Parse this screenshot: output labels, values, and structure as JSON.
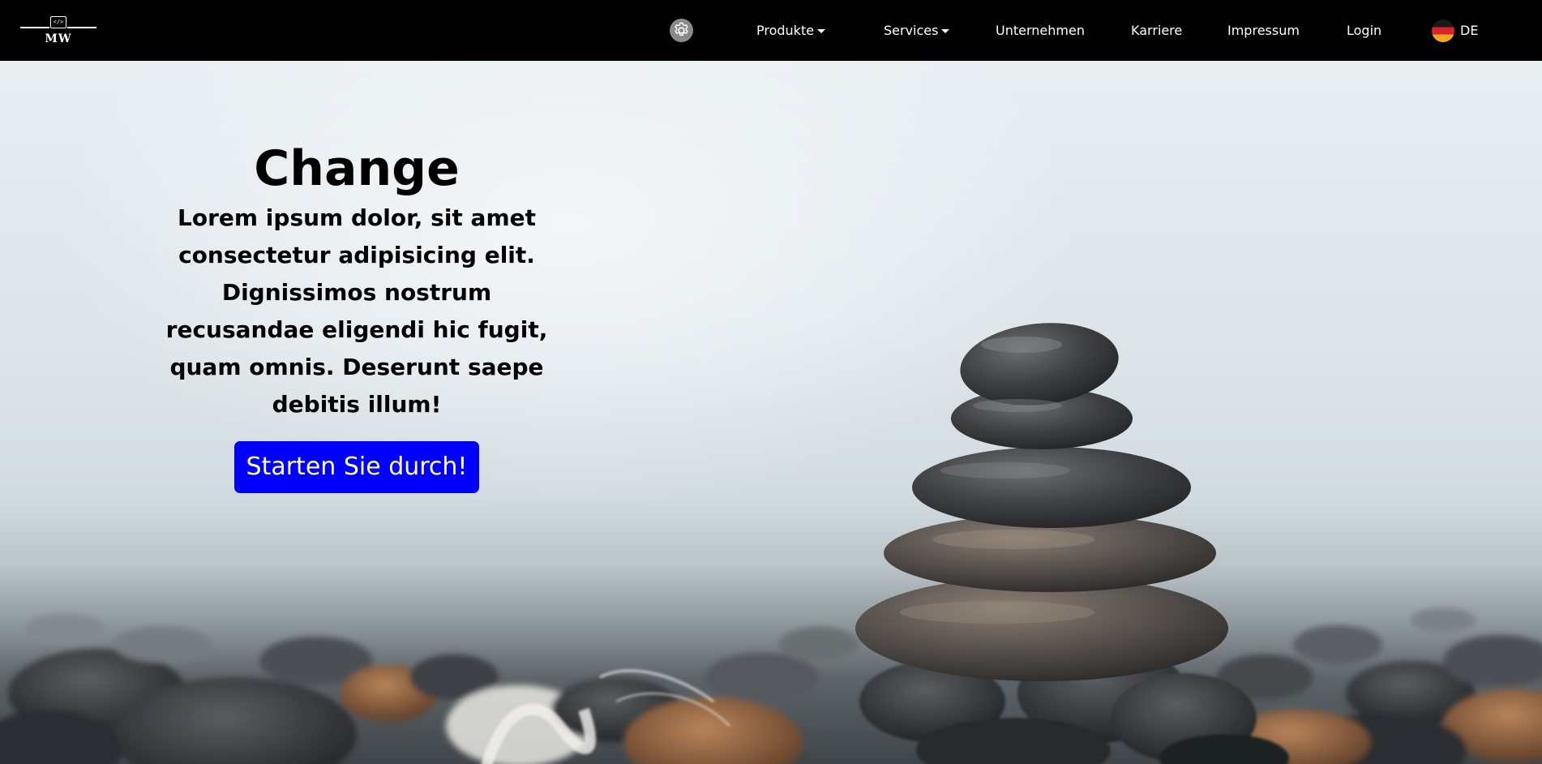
{
  "brand": {
    "logo_text": "MW",
    "logo_glyph": "</>"
  },
  "nav": {
    "settings_icon": "gear-icon",
    "items": [
      {
        "label": "Produkte",
        "dropdown": true
      },
      {
        "label": "Services",
        "dropdown": true
      },
      {
        "label": "Unternehmen",
        "dropdown": false
      },
      {
        "label": "Karriere",
        "dropdown": false
      },
      {
        "label": "Impressum",
        "dropdown": false
      },
      {
        "label": "Login",
        "dropdown": false
      }
    ],
    "language": {
      "code": "DE",
      "flag_icon": "germany-flag-icon"
    }
  },
  "hero": {
    "title": "Change",
    "text": "Lorem ipsum dolor, sit amet consectetur adipisicing elit. Dignissimos nostrum recusandae eligendi hic fugit, quam omnis. Deserunt saepe debitis illum!",
    "cta_label": "Starten Sie durch!",
    "background_image": "stacked-stones-on-beach"
  },
  "colors": {
    "navbar_bg": "#000000",
    "cta_bg": "#0000ff",
    "cta_text": "#ffffff"
  }
}
